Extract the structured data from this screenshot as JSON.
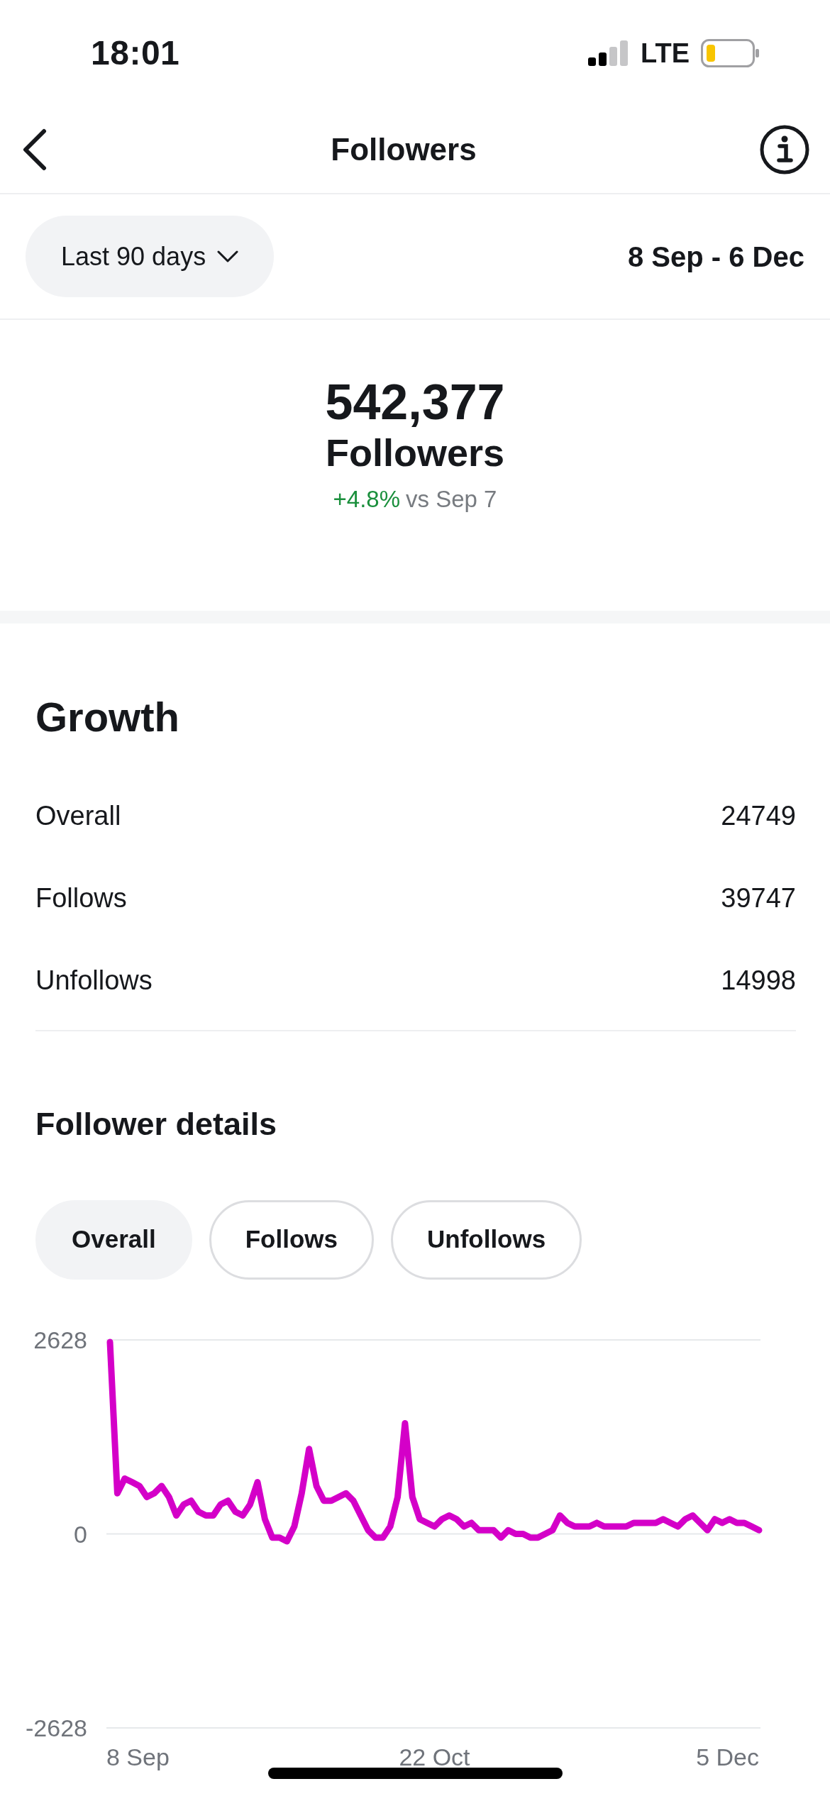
{
  "status_bar": {
    "time": "18:01",
    "network": "LTE"
  },
  "nav": {
    "title": "Followers"
  },
  "filter": {
    "range_label": "Last 90 days",
    "dates": "8 Sep - 6 Dec"
  },
  "summary": {
    "count": "542,377",
    "label": "Followers",
    "change": "+4.8%",
    "comparison": "vs Sep 7"
  },
  "growth": {
    "title": "Growth",
    "rows": [
      {
        "label": "Overall",
        "value": "24749"
      },
      {
        "label": "Follows",
        "value": "39747"
      },
      {
        "label": "Unfollows",
        "value": "14998"
      }
    ]
  },
  "details": {
    "title": "Follower details",
    "tabs": [
      {
        "label": "Overall",
        "selected": true
      },
      {
        "label": "Follows",
        "selected": false
      },
      {
        "label": "Unfollows",
        "selected": false
      }
    ],
    "x_axis_labels": [
      "8 Sep",
      "22 Oct",
      "5 Dec"
    ],
    "chart_data": {
      "type": "line",
      "ylim": [
        -2628,
        2628
      ],
      "yticks": [
        2628,
        0,
        -2628
      ],
      "series": [
        {
          "color": "#d400c8",
          "values": [
            2600,
            550,
            750,
            700,
            650,
            500,
            550,
            650,
            500,
            250,
            400,
            450,
            300,
            250,
            250,
            400,
            450,
            300,
            250,
            400,
            700,
            200,
            -50,
            -50,
            -100,
            100,
            550,
            1150,
            650,
            450,
            450,
            500,
            550,
            450,
            250,
            50,
            -50,
            -50,
            100,
            500,
            1500,
            500,
            200,
            150,
            100,
            200,
            250,
            200,
            100,
            150,
            50,
            50,
            50,
            -50,
            50,
            0,
            0,
            -50,
            -50,
            0,
            50,
            250,
            150,
            100,
            100,
            100,
            150,
            100,
            100,
            100,
            100,
            150,
            150,
            150,
            150,
            200,
            150,
            100,
            200,
            250,
            150,
            50,
            200,
            150,
            200,
            150,
            150,
            100,
            50
          ]
        }
      ]
    }
  }
}
